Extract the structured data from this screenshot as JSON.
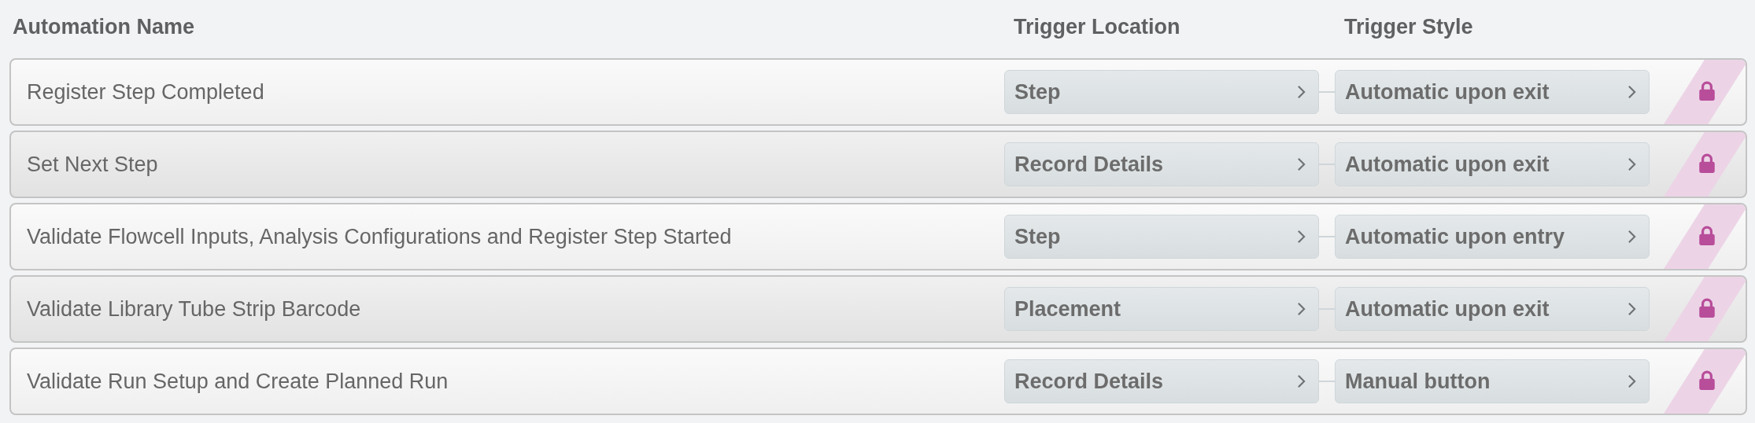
{
  "columns": [
    "Automation Name",
    "Trigger Location",
    "Trigger Style"
  ],
  "rows": [
    {
      "name": "Register Step Completed",
      "trigger_location": "Step",
      "trigger_style": "Automatic upon exit",
      "locked": true
    },
    {
      "name": "Set Next Step",
      "trigger_location": "Record Details",
      "trigger_style": "Automatic upon exit",
      "locked": true
    },
    {
      "name": "Validate Flowcell Inputs, Analysis Configurations and Register Step Started",
      "trigger_location": "Step",
      "trigger_style": "Automatic upon entry",
      "locked": true
    },
    {
      "name": "Validate Library Tube Strip Barcode",
      "trigger_location": "Placement",
      "trigger_style": "Automatic upon exit",
      "locked": true
    },
    {
      "name": "Validate Run Setup and Create Planned Run",
      "trigger_location": "Record Details",
      "trigger_style": "Manual button",
      "locked": true
    }
  ]
}
